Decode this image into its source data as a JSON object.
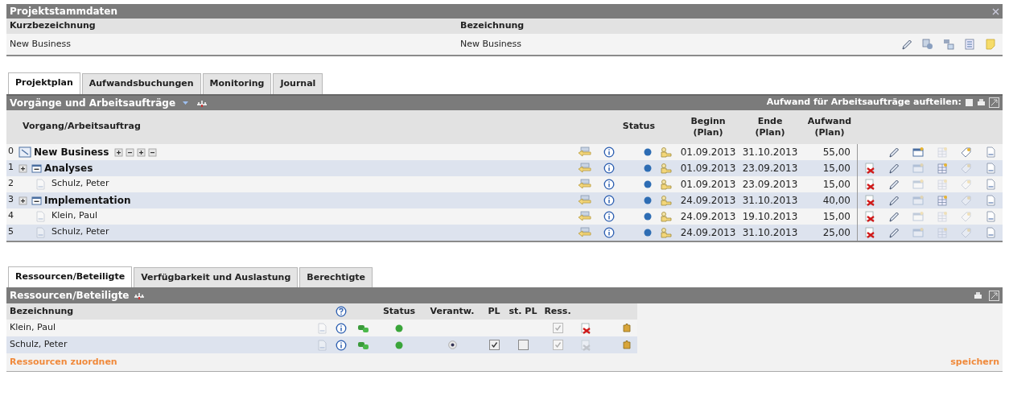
{
  "project_panel": {
    "title": "Projektstammdaten",
    "fields": [
      {
        "label": "Kurzbezeichnung",
        "value": "New Business"
      },
      {
        "label": "Bezeichnung",
        "value": "New Business"
      }
    ]
  },
  "project_tabs": [
    {
      "label": "Projektplan",
      "selected": true
    },
    {
      "label": "Aufwandsbuchungen",
      "selected": false
    },
    {
      "label": "Monitoring",
      "selected": false
    },
    {
      "label": "Journal",
      "selected": false
    }
  ],
  "tasks_panel": {
    "title": "Vorgänge und Arbeitsaufträge",
    "split_label": "Aufwand für Arbeitsaufträge aufteilen:",
    "columns": {
      "name": "Vorgang/Arbeitsauftrag",
      "status": "Status",
      "begin": "Beginn (Plan)",
      "end": "Ende (Plan)",
      "effort": "Aufwand (Plan)"
    },
    "rows": [
      {
        "number": "0",
        "name": "New Business",
        "kind": "project",
        "begin": "01.09.2013",
        "end": "31.10.2013",
        "effort": "55,00",
        "deletable": false,
        "children": [
          {
            "number": "1",
            "name": "Analyses",
            "kind": "task",
            "expanded": true,
            "begin": "01.09.2013",
            "end": "23.09.2013",
            "effort": "15,00",
            "deletable": true,
            "children": [
              {
                "number": "2",
                "name": "Schulz, Peter",
                "kind": "order",
                "begin": "01.09.2013",
                "end": "23.09.2013",
                "effort": "15,00",
                "deletable": true
              }
            ]
          },
          {
            "number": "3",
            "name": "Implementation",
            "kind": "task",
            "expanded": true,
            "begin": "24.09.2013",
            "end": "31.10.2013",
            "effort": "40,00",
            "deletable": true,
            "children": [
              {
                "number": "4",
                "name": "Klein, Paul",
                "kind": "order",
                "begin": "24.09.2013",
                "end": "19.10.2013",
                "effort": "15,00",
                "deletable": true
              },
              {
                "number": "5",
                "name": "Schulz, Peter",
                "kind": "order",
                "begin": "24.09.2013",
                "end": "31.10.2013",
                "effort": "25,00",
                "deletable": true
              }
            ]
          }
        ]
      }
    ]
  },
  "resource_tabs": [
    {
      "label": "Ressourcen/Beteiligte",
      "selected": true
    },
    {
      "label": "Verfügbarkeit und Auslastung",
      "selected": false
    },
    {
      "label": "Berechtigte",
      "selected": false
    }
  ],
  "resources_panel": {
    "title": "Ressourcen/Beteiligte",
    "columns": {
      "name": "Bezeichnung",
      "status": "Status",
      "responsible": "Verantw.",
      "pl": "PL",
      "st_pl": "st. PL",
      "ress": "Ress."
    },
    "rows": [
      {
        "name": "Klein, Paul",
        "ress": {
          "checked": true
        },
        "deletable": true
      },
      {
        "name": "Schulz, Peter",
        "responsible": {
          "selected": true
        },
        "pl": {
          "checked": true
        },
        "st_pl": {
          "checked": false
        },
        "ress": {
          "checked": true
        },
        "deletable": false
      }
    ],
    "assign_link": "Ressourcen zuordnen",
    "save_link": "speichern"
  }
}
